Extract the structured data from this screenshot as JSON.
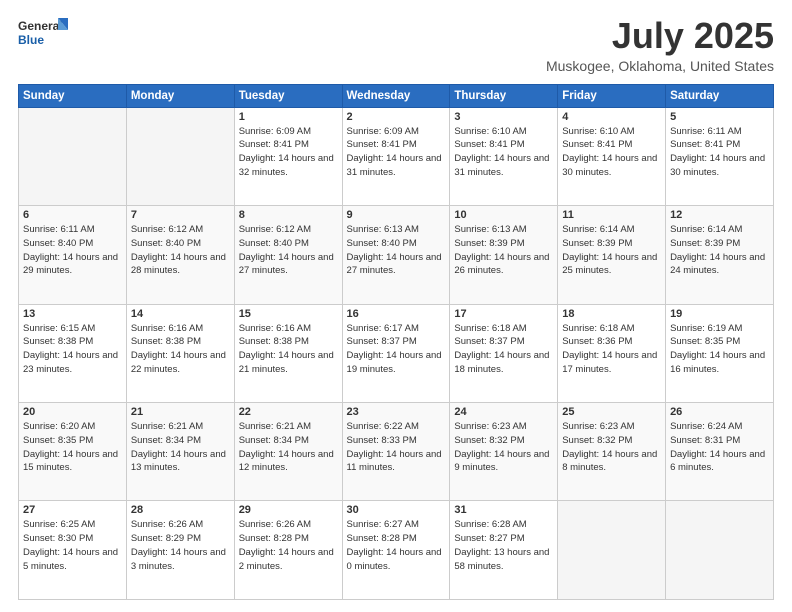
{
  "header": {
    "logo_line1": "General",
    "logo_line2": "Blue",
    "month_title": "July 2025",
    "location": "Muskogee, Oklahoma, United States"
  },
  "weekdays": [
    "Sunday",
    "Monday",
    "Tuesday",
    "Wednesday",
    "Thursday",
    "Friday",
    "Saturday"
  ],
  "weeks": [
    [
      {
        "day": "",
        "content": ""
      },
      {
        "day": "",
        "content": ""
      },
      {
        "day": "1",
        "content": "Sunrise: 6:09 AM\nSunset: 8:41 PM\nDaylight: 14 hours and 32 minutes."
      },
      {
        "day": "2",
        "content": "Sunrise: 6:09 AM\nSunset: 8:41 PM\nDaylight: 14 hours and 31 minutes."
      },
      {
        "day": "3",
        "content": "Sunrise: 6:10 AM\nSunset: 8:41 PM\nDaylight: 14 hours and 31 minutes."
      },
      {
        "day": "4",
        "content": "Sunrise: 6:10 AM\nSunset: 8:41 PM\nDaylight: 14 hours and 30 minutes."
      },
      {
        "day": "5",
        "content": "Sunrise: 6:11 AM\nSunset: 8:41 PM\nDaylight: 14 hours and 30 minutes."
      }
    ],
    [
      {
        "day": "6",
        "content": "Sunrise: 6:11 AM\nSunset: 8:40 PM\nDaylight: 14 hours and 29 minutes."
      },
      {
        "day": "7",
        "content": "Sunrise: 6:12 AM\nSunset: 8:40 PM\nDaylight: 14 hours and 28 minutes."
      },
      {
        "day": "8",
        "content": "Sunrise: 6:12 AM\nSunset: 8:40 PM\nDaylight: 14 hours and 27 minutes."
      },
      {
        "day": "9",
        "content": "Sunrise: 6:13 AM\nSunset: 8:40 PM\nDaylight: 14 hours and 27 minutes."
      },
      {
        "day": "10",
        "content": "Sunrise: 6:13 AM\nSunset: 8:39 PM\nDaylight: 14 hours and 26 minutes."
      },
      {
        "day": "11",
        "content": "Sunrise: 6:14 AM\nSunset: 8:39 PM\nDaylight: 14 hours and 25 minutes."
      },
      {
        "day": "12",
        "content": "Sunrise: 6:14 AM\nSunset: 8:39 PM\nDaylight: 14 hours and 24 minutes."
      }
    ],
    [
      {
        "day": "13",
        "content": "Sunrise: 6:15 AM\nSunset: 8:38 PM\nDaylight: 14 hours and 23 minutes."
      },
      {
        "day": "14",
        "content": "Sunrise: 6:16 AM\nSunset: 8:38 PM\nDaylight: 14 hours and 22 minutes."
      },
      {
        "day": "15",
        "content": "Sunrise: 6:16 AM\nSunset: 8:38 PM\nDaylight: 14 hours and 21 minutes."
      },
      {
        "day": "16",
        "content": "Sunrise: 6:17 AM\nSunset: 8:37 PM\nDaylight: 14 hours and 19 minutes."
      },
      {
        "day": "17",
        "content": "Sunrise: 6:18 AM\nSunset: 8:37 PM\nDaylight: 14 hours and 18 minutes."
      },
      {
        "day": "18",
        "content": "Sunrise: 6:18 AM\nSunset: 8:36 PM\nDaylight: 14 hours and 17 minutes."
      },
      {
        "day": "19",
        "content": "Sunrise: 6:19 AM\nSunset: 8:35 PM\nDaylight: 14 hours and 16 minutes."
      }
    ],
    [
      {
        "day": "20",
        "content": "Sunrise: 6:20 AM\nSunset: 8:35 PM\nDaylight: 14 hours and 15 minutes."
      },
      {
        "day": "21",
        "content": "Sunrise: 6:21 AM\nSunset: 8:34 PM\nDaylight: 14 hours and 13 minutes."
      },
      {
        "day": "22",
        "content": "Sunrise: 6:21 AM\nSunset: 8:34 PM\nDaylight: 14 hours and 12 minutes."
      },
      {
        "day": "23",
        "content": "Sunrise: 6:22 AM\nSunset: 8:33 PM\nDaylight: 14 hours and 11 minutes."
      },
      {
        "day": "24",
        "content": "Sunrise: 6:23 AM\nSunset: 8:32 PM\nDaylight: 14 hours and 9 minutes."
      },
      {
        "day": "25",
        "content": "Sunrise: 6:23 AM\nSunset: 8:32 PM\nDaylight: 14 hours and 8 minutes."
      },
      {
        "day": "26",
        "content": "Sunrise: 6:24 AM\nSunset: 8:31 PM\nDaylight: 14 hours and 6 minutes."
      }
    ],
    [
      {
        "day": "27",
        "content": "Sunrise: 6:25 AM\nSunset: 8:30 PM\nDaylight: 14 hours and 5 minutes."
      },
      {
        "day": "28",
        "content": "Sunrise: 6:26 AM\nSunset: 8:29 PM\nDaylight: 14 hours and 3 minutes."
      },
      {
        "day": "29",
        "content": "Sunrise: 6:26 AM\nSunset: 8:28 PM\nDaylight: 14 hours and 2 minutes."
      },
      {
        "day": "30",
        "content": "Sunrise: 6:27 AM\nSunset: 8:28 PM\nDaylight: 14 hours and 0 minutes."
      },
      {
        "day": "31",
        "content": "Sunrise: 6:28 AM\nSunset: 8:27 PM\nDaylight: 13 hours and 58 minutes."
      },
      {
        "day": "",
        "content": ""
      },
      {
        "day": "",
        "content": ""
      }
    ]
  ]
}
